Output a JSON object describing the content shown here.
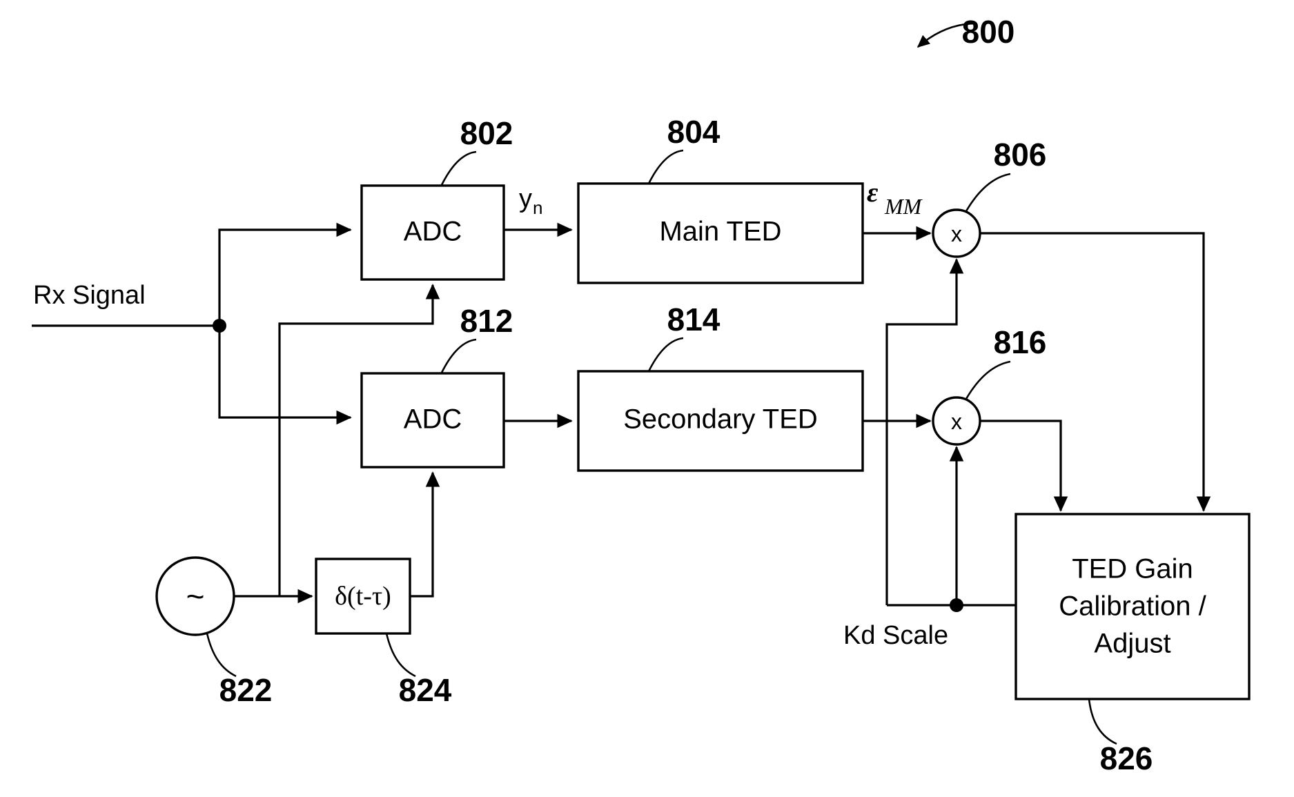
{
  "figure": {
    "number": "800",
    "title_ref": "800"
  },
  "blocks": [
    {
      "id": "adc1",
      "label": "ADC",
      "ref": "802"
    },
    {
      "id": "mainted",
      "label": "Main TED",
      "ref": "804"
    },
    {
      "id": "adc2",
      "label": "ADC",
      "ref": "812"
    },
    {
      "id": "sected",
      "label": "Secondary TED",
      "ref": "814"
    },
    {
      "id": "tedgain",
      "label_line1": "TED Gain",
      "label_line2": "Calibration /",
      "label_line3": "Adjust",
      "ref": "826"
    }
  ],
  "multipliers": [
    {
      "id": "mult1",
      "glyph": "x",
      "ref": "806"
    },
    {
      "id": "mult2",
      "glyph": "x",
      "ref": "816"
    }
  ],
  "oscillator": {
    "glyph": "~",
    "ref": "822"
  },
  "delay": {
    "label": "δ(t-τ)",
    "ref": "824"
  },
  "signals": {
    "rx": "Rx Signal",
    "yn_main": "y",
    "yn_sub": "n",
    "eps_main": "ε",
    "eps_sub": "MM",
    "kd": "Kd Scale"
  },
  "colors": {
    "ink": "#000000",
    "paper": "#ffffff"
  }
}
